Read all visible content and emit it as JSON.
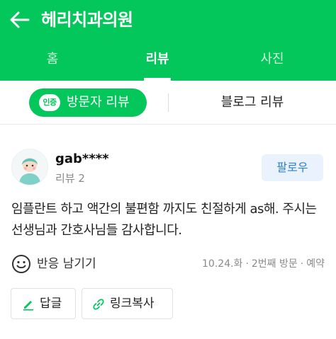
{
  "header": {
    "title": "헤리치과의원"
  },
  "tabs": [
    {
      "label": "홈"
    },
    {
      "label": "리뷰"
    },
    {
      "label": "사진"
    }
  ],
  "subtabs": {
    "visitor": {
      "badge": "인증",
      "label": "방문자 리뷰"
    },
    "blog": {
      "label": "블로그 리뷰"
    }
  },
  "review": {
    "user": {
      "name": "gab****",
      "reviews": "리뷰 2"
    },
    "follow_label": "팔로우",
    "text": "임플란트 하고 액간의 불편함 까지도 친절하게 as해. 주시는 선생님과 간호사님들 감사합니다.",
    "react_label": "반응 남기기",
    "meta": {
      "date": "10.24.화",
      "visit": "2번째 방문",
      "type": "예약"
    },
    "actions": {
      "reply": "답글",
      "copy_link": "링크복사"
    }
  },
  "colors": {
    "brand": "#03c75a",
    "follow_bg": "#eaf3fd",
    "follow_text": "#2b7fd4"
  },
  "icons": [
    "back-arrow-icon",
    "verified-badge-icon",
    "smile-icon",
    "pencil-icon",
    "link-icon"
  ]
}
